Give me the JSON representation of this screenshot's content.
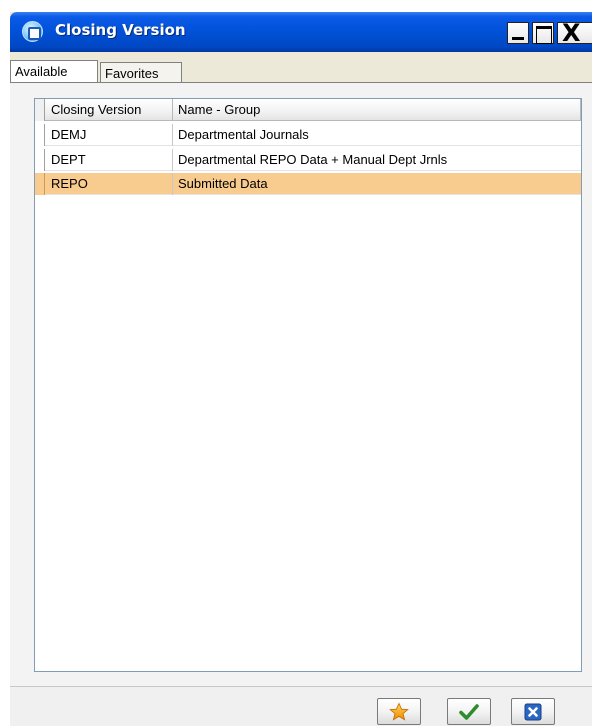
{
  "window": {
    "title": "Closing Version",
    "colors": {
      "titlebar": "#0051d7",
      "selection": "#f8cc8e"
    },
    "icons": {
      "app": "app-icon",
      "minimize": "minimize-icon",
      "maximize": "maximize-icon",
      "close": "close-icon"
    },
    "close_glyph": "X"
  },
  "tabs": [
    {
      "label": "Available",
      "active": true
    },
    {
      "label": "Favorites",
      "active": false
    }
  ],
  "grid": {
    "columns": [
      "Closing Version",
      "Name - Group"
    ],
    "rows": [
      {
        "code": "DEMJ",
        "name": "Departmental Journals",
        "selected": false
      },
      {
        "code": "DEPT",
        "name": "Departmental REPO Data + Manual Dept Jrnls",
        "selected": false
      },
      {
        "code": "REPO",
        "name": "Submitted Data",
        "selected": true
      }
    ]
  },
  "footer": {
    "buttons": [
      {
        "icon": "star-icon"
      },
      {
        "icon": "checkmark-icon"
      },
      {
        "icon": "cancel-icon"
      }
    ]
  }
}
